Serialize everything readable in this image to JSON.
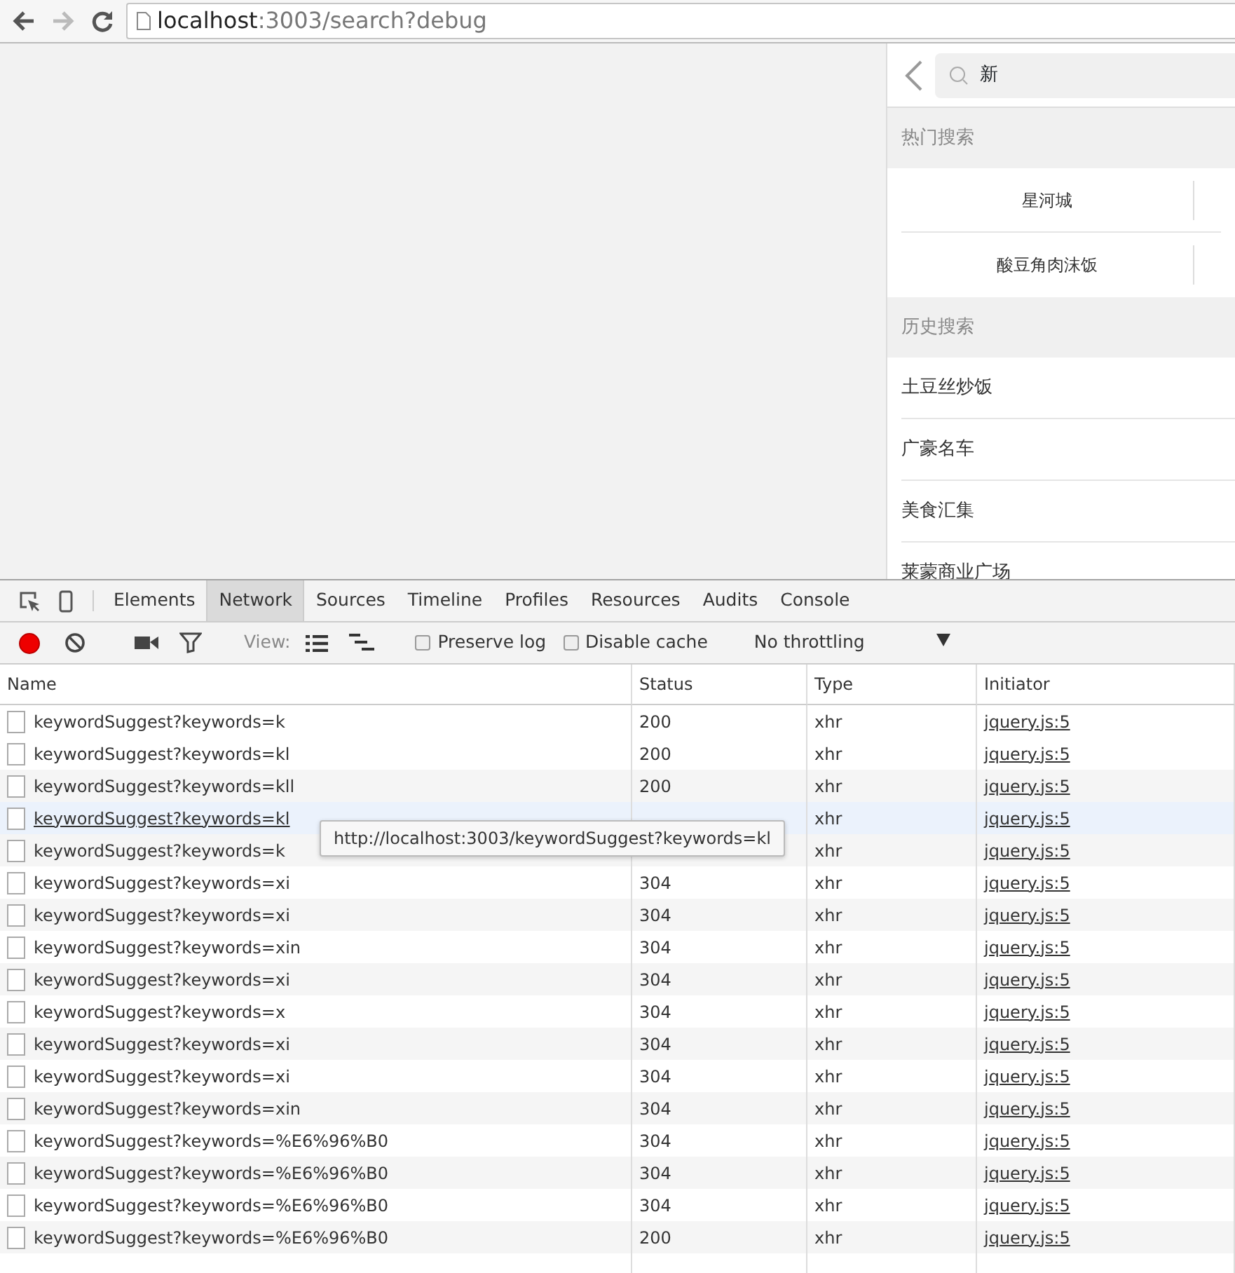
{
  "browser": {
    "url_host": "localhost",
    "url_rest": ":3003/search?debug"
  },
  "mobile": {
    "search_value": "新",
    "hot_title": "热门搜索",
    "hot_items": [
      "星河城",
      "酸豆角肉沫饭"
    ],
    "history_title": "历史搜索",
    "history_items": [
      "土豆丝炒饭",
      "广豪名车",
      "美食汇集",
      "莱蒙商业广场"
    ]
  },
  "devtools": {
    "tabs": [
      {
        "label": "Elements",
        "selected": false
      },
      {
        "label": "Network",
        "selected": true
      },
      {
        "label": "Sources",
        "selected": false
      },
      {
        "label": "Timeline",
        "selected": false
      },
      {
        "label": "Profiles",
        "selected": false
      },
      {
        "label": "Resources",
        "selected": false
      },
      {
        "label": "Audits",
        "selected": false
      },
      {
        "label": "Console",
        "selected": false
      }
    ],
    "recording": true,
    "view_label": "View:",
    "preserve_log": {
      "label": "Preserve log",
      "checked": false
    },
    "disable_cache": {
      "label": "Disable cache",
      "checked": false
    },
    "throttling": "No throttling"
  },
  "table": {
    "columns": [
      "Name",
      "Status",
      "Type",
      "Initiator"
    ],
    "rows": [
      {
        "name": "keywordSuggest?keywords=k",
        "status": "200",
        "type": "xhr",
        "initiator": "jquery.js:5",
        "hovered": false
      },
      {
        "name": "keywordSuggest?keywords=kl",
        "status": "200",
        "type": "xhr",
        "initiator": "jquery.js:5",
        "hovered": false
      },
      {
        "name": "keywordSuggest?keywords=kll",
        "status": "200",
        "type": "xhr",
        "initiator": "jquery.js:5",
        "hovered": false
      },
      {
        "name": "keywordSuggest?keywords=kl",
        "type": "xhr",
        "initiator": "jquery.js:5",
        "hovered": true
      },
      {
        "name": "keywordSuggest?keywords=k",
        "type": "xhr",
        "initiator": "jquery.js:5",
        "hovered": false
      },
      {
        "name": "keywordSuggest?keywords=xi",
        "status": "304",
        "type": "xhr",
        "initiator": "jquery.js:5",
        "hovered": false
      },
      {
        "name": "keywordSuggest?keywords=xi",
        "status": "304",
        "type": "xhr",
        "initiator": "jquery.js:5",
        "hovered": false
      },
      {
        "name": "keywordSuggest?keywords=xin",
        "status": "304",
        "type": "xhr",
        "initiator": "jquery.js:5",
        "hovered": false
      },
      {
        "name": "keywordSuggest?keywords=xi",
        "status": "304",
        "type": "xhr",
        "initiator": "jquery.js:5",
        "hovered": false
      },
      {
        "name": "keywordSuggest?keywords=x",
        "status": "304",
        "type": "xhr",
        "initiator": "jquery.js:5",
        "hovered": false
      },
      {
        "name": "keywordSuggest?keywords=xi",
        "status": "304",
        "type": "xhr",
        "initiator": "jquery.js:5",
        "hovered": false
      },
      {
        "name": "keywordSuggest?keywords=xi",
        "status": "304",
        "type": "xhr",
        "initiator": "jquery.js:5",
        "hovered": false
      },
      {
        "name": "keywordSuggest?keywords=xin",
        "status": "304",
        "type": "xhr",
        "initiator": "jquery.js:5",
        "hovered": false
      },
      {
        "name": "keywordSuggest?keywords=%E6%96%B0",
        "status": "304",
        "type": "xhr",
        "initiator": "jquery.js:5",
        "hovered": false
      },
      {
        "name": "keywordSuggest?keywords=%E6%96%B0",
        "status": "304",
        "type": "xhr",
        "initiator": "jquery.js:5",
        "hovered": false
      },
      {
        "name": "keywordSuggest?keywords=%E6%96%B0",
        "status": "304",
        "type": "xhr",
        "initiator": "jquery.js:5",
        "hovered": false
      },
      {
        "name": "keywordSuggest?keywords=%E6%96%B0",
        "status": "200",
        "type": "xhr",
        "initiator": "jquery.js:5",
        "hovered": false
      }
    ],
    "tooltip": "http://localhost:3003/keywordSuggest?keywords=kl"
  }
}
